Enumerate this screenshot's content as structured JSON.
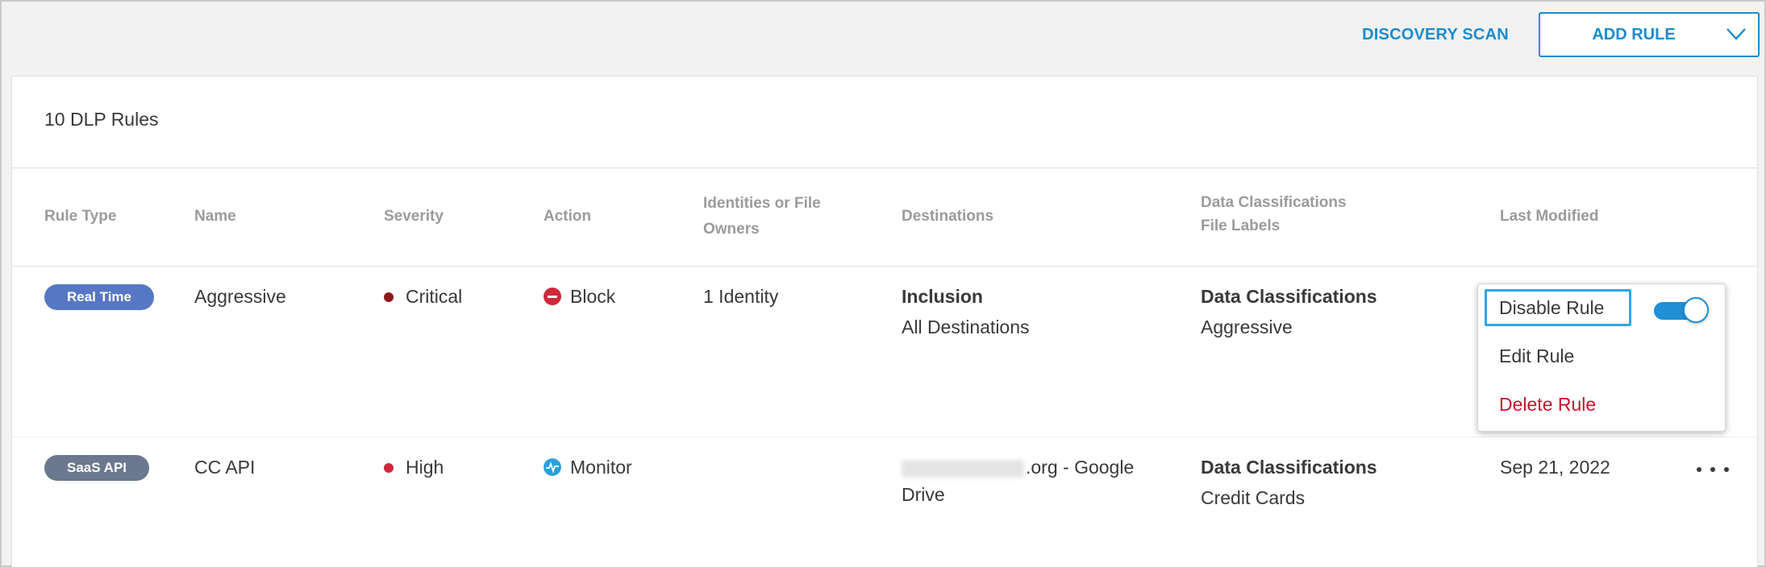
{
  "toolbar": {
    "discovery_scan": "DISCOVERY SCAN",
    "add_rule": "ADD RULE"
  },
  "summary": {
    "count_label": "10 DLP Rules"
  },
  "table": {
    "headers": {
      "rule_type": "Rule Type",
      "name": "Name",
      "severity": "Severity",
      "action": "Action",
      "identities_line1": "Identities or File",
      "identities_line2": "Owners",
      "destinations": "Destinations",
      "classifications_line1": "Data Classifications",
      "classifications_line2": "File Labels",
      "last_modified": "Last Modified"
    },
    "rows": [
      {
        "rule_type": "Real Time",
        "name": "Aggressive",
        "severity": "Critical",
        "action": "Block",
        "identities": "1 Identity",
        "destinations_title": "Inclusion",
        "destinations_value": "All Destinations",
        "classifications_title": "Data Classifications",
        "classifications_value": "Aggressive",
        "last_modified": ""
      },
      {
        "rule_type": "SaaS API",
        "name": "CC API",
        "severity": "High",
        "action": "Monitor",
        "identities": "",
        "destinations_line1_suffix": ".org - Google",
        "destinations_line2": "Drive",
        "classifications_title": "Data Classifications",
        "classifications_value": "Credit Cards",
        "last_modified": "Sep 21, 2022"
      }
    ]
  },
  "menu": {
    "disable_rule": "Disable Rule",
    "edit_rule": "Edit Rule",
    "delete_rule": "Delete Rule",
    "toggle_on": true
  },
  "colors": {
    "accent": "#1a8ccc",
    "real_time_pill": "#5677c4",
    "saas_api_pill": "#6b7890",
    "critical_dot": "#8c1a1a",
    "high_dot": "#d0283a",
    "block_icon": "#d0283a",
    "monitor_icon": "#2aa0dc",
    "delete_text": "#c8102e"
  },
  "icons": {
    "add_rule_dropdown": "chevron-down-icon",
    "block": "block-icon",
    "monitor": "monitor-pulse-icon",
    "more": "more-options-icon"
  }
}
